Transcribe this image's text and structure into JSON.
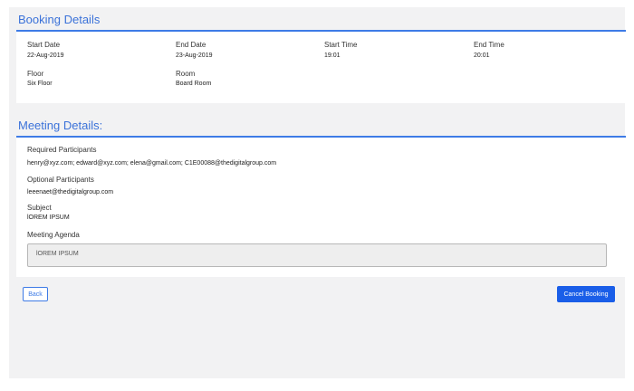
{
  "booking": {
    "title": "Booking Details",
    "start_date_label": "Start Date",
    "start_date": "22-Aug-2019",
    "end_date_label": "End Date",
    "end_date": "23-Aug-2019",
    "start_time_label": "Start Time",
    "start_time": "19:01",
    "end_time_label": "End Time",
    "end_time": "20:01",
    "floor_label": "Floor",
    "floor": "Six Floor",
    "room_label": "Room",
    "room": "Board Room"
  },
  "meeting": {
    "title": "Meeting Details:",
    "required_label": "Required Participants",
    "required": "henry@xyz.com; edward@xyz.com; elena@gmail.com; C1E00088@thedigitalgroup.com",
    "optional_label": "Optional Participants",
    "optional": "leeenaet@thedigitalgroup.com",
    "subject_label": "Subject",
    "subject": "lOREM IPSUM",
    "agenda_label": "Meeting Agenda",
    "agenda": "lOREM IPSUM"
  },
  "actions": {
    "back_label": "Back",
    "cancel_label": "Cancel Booking"
  },
  "colors": {
    "accent": "#3e7be6",
    "primary_button": "#1a5ee8",
    "panel_background": "#f2f2f3"
  }
}
